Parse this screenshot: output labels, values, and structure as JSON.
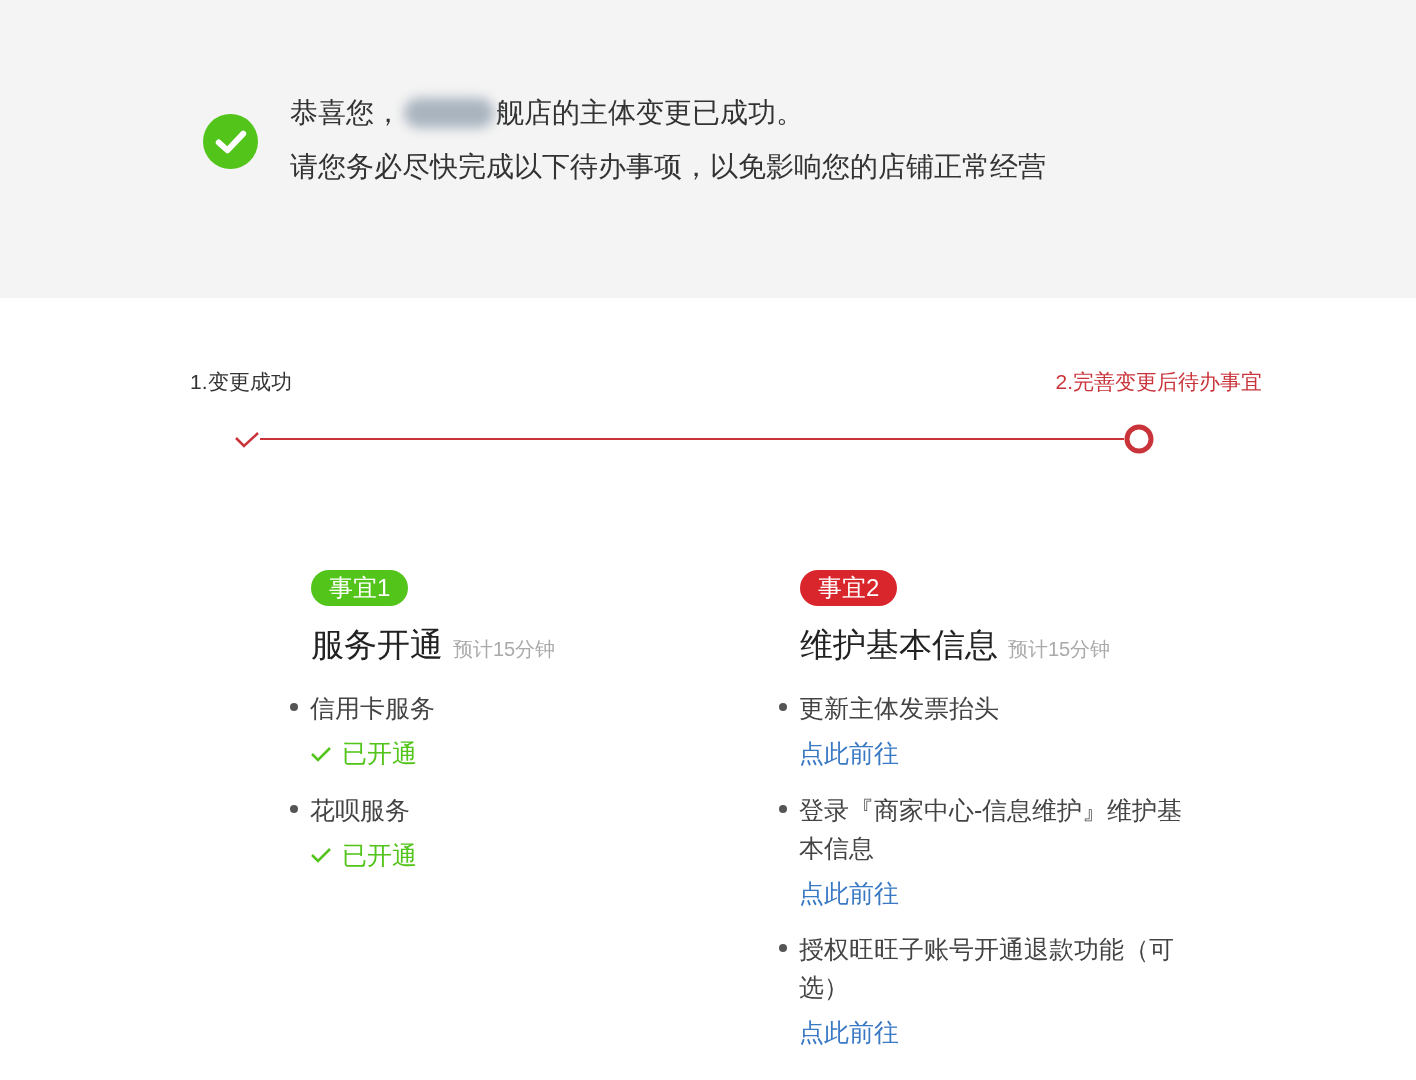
{
  "banner": {
    "greeting_start": "恭喜您，",
    "greeting_end": "舰店的主体变更已成功。",
    "instruction": "请您务必尽快完成以下待办事项，以免影响您的店铺正常经营"
  },
  "steps": [
    {
      "label": "1.变更成功",
      "completed": true,
      "selected": false
    },
    {
      "label": "2.完善变更后待办事宜",
      "completed": false,
      "selected": true
    }
  ],
  "tasks": [
    {
      "badge": "事宜1",
      "color": "#52c41a",
      "title": "服务开通",
      "estimate": "预计15分钟",
      "items": [
        {
          "text": "信用卡服务",
          "action": {
            "kind": "status",
            "text": "已开通"
          }
        },
        {
          "text": "花呗服务",
          "action": {
            "kind": "status",
            "text": "已开通"
          }
        }
      ]
    },
    {
      "badge": "事宜2",
      "color": "#d9262c",
      "title": "维护基本信息",
      "estimate": "预计15分钟",
      "items": [
        {
          "text": "更新主体发票抬头",
          "action": {
            "kind": "link",
            "text": "点此前往"
          }
        },
        {
          "text": "登录『商家中心-信息维护』维护基本信息",
          "action": {
            "kind": "link",
            "text": "点此前往"
          }
        },
        {
          "text": "授权旺旺子账号开通退款功能（可选）",
          "action": {
            "kind": "link",
            "text": "点此前往"
          }
        }
      ]
    }
  ]
}
